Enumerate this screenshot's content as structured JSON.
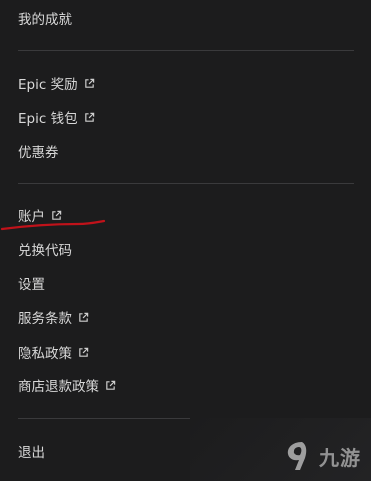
{
  "menu": {
    "achievements_label": "我的成就",
    "epic_rewards_label": "Epic 奖励",
    "epic_wallet_label": "Epic 钱包",
    "coupons_label": "优惠券",
    "account_label": "账户",
    "redeem_code_label": "兑换代码",
    "settings_label": "设置",
    "terms_label": "服务条款",
    "privacy_label": "隐私政策",
    "refund_policy_label": "商店退款政策",
    "sign_out_label": "退出"
  },
  "watermark": {
    "text": "九游"
  },
  "colors": {
    "background": "#1c1c1d",
    "text": "#d8d8d8",
    "divider": "#3a3a3c",
    "annotation": "#c0121a"
  }
}
